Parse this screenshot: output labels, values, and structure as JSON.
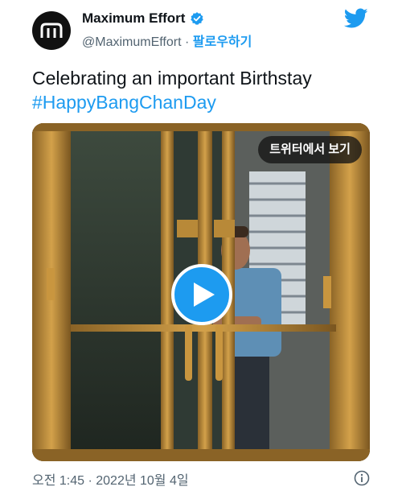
{
  "author": {
    "display_name": "Maximum Effort",
    "handle": "@MaximumEffort",
    "separator": "·",
    "follow_label": "팔로우하기"
  },
  "tweet": {
    "text": "Celebrating an important Birthstay",
    "hashtag": "#HappyBangChanDay"
  },
  "media": {
    "view_on_twitter_label": "트위터에서 보기"
  },
  "meta": {
    "timestamp": "오전 1:45 · 2022년 10월 4일"
  },
  "colors": {
    "accent": "#1d9bf0",
    "text": "#0f1419",
    "muted": "#536471"
  },
  "icons": {
    "avatar": "maximum-effort-logo-icon",
    "verified": "verified-badge-icon",
    "brand": "twitter-bird-icon",
    "play": "play-icon",
    "info": "info-icon"
  }
}
